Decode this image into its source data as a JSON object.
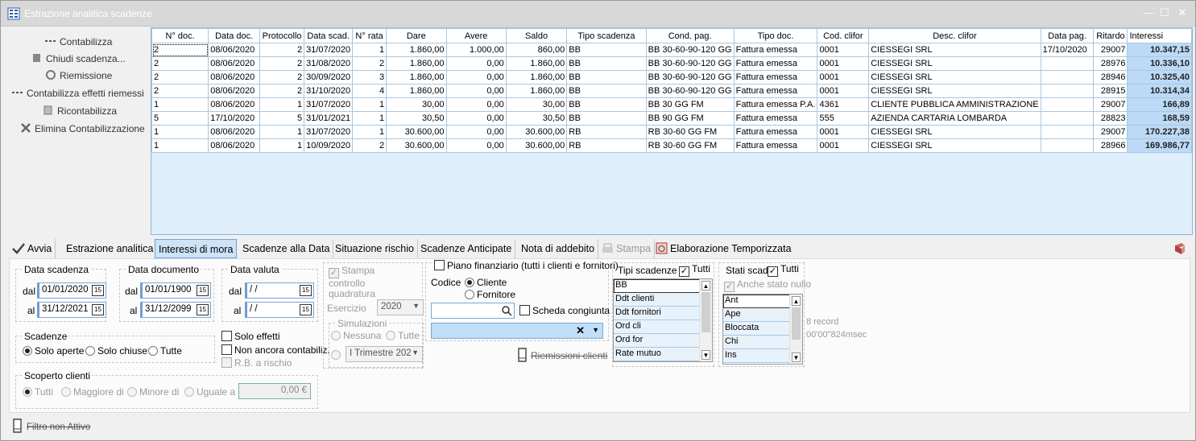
{
  "window": {
    "title": "Estrazione analitica scadenze",
    "min": "—",
    "max": "☐",
    "close": "✕"
  },
  "sidebar": {
    "items": [
      {
        "label": "Contabilizza",
        "icon": "dashes-icon"
      },
      {
        "label": "Chiudi scadenza...",
        "icon": "document-icon"
      },
      {
        "label": "Riemissione",
        "icon": "recycle-icon"
      },
      {
        "label": "Contabilizza effetti riemessi",
        "icon": "dashes-icon"
      },
      {
        "label": "Ricontabilizza",
        "icon": "document-icon"
      },
      {
        "label": "Elimina Contabilizzazione",
        "icon": "delete-icon"
      }
    ]
  },
  "grid": {
    "columns": [
      "N° doc.",
      "Data doc.",
      "Protocollo",
      "Data scad.",
      "N° rata",
      "Dare",
      "Avere",
      "Saldo",
      "Tipo scadenza",
      "Cond. pag.",
      "Tipo doc.",
      "Cod. clifor",
      "Desc. clifor",
      "Data pag.",
      "Ritardo",
      "Interessi"
    ],
    "rows": [
      [
        "2",
        "08/06/2020",
        "2",
        "31/07/2020",
        "1",
        "1.860,00",
        "1.000,00",
        "860,00",
        "BB",
        "BB 30-60-90-120 GG",
        "Fattura emessa",
        "0001",
        "CIESSEGI SRL",
        "17/10/2020",
        "29007",
        "10.347,15"
      ],
      [
        "2",
        "08/06/2020",
        "2",
        "31/08/2020",
        "2",
        "1.860,00",
        "0,00",
        "1.860,00",
        "BB",
        "BB 30-60-90-120 GG",
        "Fattura emessa",
        "0001",
        "CIESSEGI SRL",
        "",
        "28976",
        "10.336,10"
      ],
      [
        "2",
        "08/06/2020",
        "2",
        "30/09/2020",
        "3",
        "1.860,00",
        "0,00",
        "1.860,00",
        "BB",
        "BB 30-60-90-120 GG",
        "Fattura emessa",
        "0001",
        "CIESSEGI SRL",
        "",
        "28946",
        "10.325,40"
      ],
      [
        "2",
        "08/06/2020",
        "2",
        "31/10/2020",
        "4",
        "1.860,00",
        "0,00",
        "1.860,00",
        "BB",
        "BB 30-60-90-120 GG",
        "Fattura emessa",
        "0001",
        "CIESSEGI SRL",
        "",
        "28915",
        "10.314,34"
      ],
      [
        "1",
        "08/06/2020",
        "1",
        "31/07/2020",
        "1",
        "30,00",
        "0,00",
        "30,00",
        "BB",
        "BB 30 GG FM",
        "Fattura emessa P.A.",
        "4361",
        "CLIENTE PUBBLICA AMMINISTRAZIONE",
        "",
        "29007",
        "166,89"
      ],
      [
        "5",
        "17/10/2020",
        "5",
        "31/01/2021",
        "1",
        "30,50",
        "0,00",
        "30,50",
        "BB",
        "BB 90 GG FM",
        "Fattura emessa",
        "555",
        "AZIENDA CARTARIA LOMBARDA",
        "",
        "28823",
        "168,59"
      ],
      [
        "1",
        "08/06/2020",
        "1",
        "31/07/2020",
        "1",
        "30.600,00",
        "0,00",
        "30.600,00",
        "RB",
        "RB 30-60 GG FM",
        "Fattura emessa",
        "0001",
        "CIESSEGI SRL",
        "",
        "29007",
        "170.227,38"
      ],
      [
        "1",
        "08/06/2020",
        "1",
        "10/09/2020",
        "2",
        "30.600,00",
        "0,00",
        "30.600,00",
        "RB",
        "RB 30-60 GG FM",
        "Fattura emessa",
        "0001",
        "CIESSEGI SRL",
        "",
        "28966",
        "169.986,77"
      ]
    ]
  },
  "tabs": {
    "avvia": "Avvia",
    "estrazione": "Estrazione analitica",
    "interessi": "Interessi di mora",
    "scadenze_data": "Scadenze alla Data",
    "rischio": "Situazione rischio",
    "anticipate": "Scadenze Anticipate",
    "nota": "Nota di addebito",
    "stampa": "Stampa",
    "elaborazione": "Elaborazione Temporizzata"
  },
  "filters": {
    "data_scadenza": {
      "title": "Data scadenza",
      "dal_label": "dal",
      "al_label": "al",
      "dal": "01/01/2020",
      "al": "31/12/2021"
    },
    "data_documento": {
      "title": "Data documento",
      "dal_label": "dal",
      "al_label": "al",
      "dal": "01/01/1900",
      "al": "31/12/2099"
    },
    "data_valuta": {
      "title": "Data valuta",
      "dal_label": "dal",
      "al_label": "al",
      "dal": " / /",
      "al": " / /"
    },
    "cal_glyph": "15",
    "scadenze": {
      "title": "Scadenze",
      "aperte": "Solo aperte",
      "chiuse": "Solo chiuse",
      "tutte": "Tutte"
    },
    "solo_effetti": "Solo effetti",
    "non_contab": "Non ancora contabiliz.",
    "rb_rischio": "R.B. a rischio",
    "scoperto": {
      "title": "Scoperto clienti",
      "tutti": "Tutti",
      "maggiore": "Maggiore di",
      "minore": "Minore di",
      "uguale": "Uguale a",
      "value": "0,00 €"
    },
    "stampa_controllo": "Stampa controllo quadratura",
    "esercizio_label": "Esercizio",
    "esercizio": "2020",
    "simulazioni": {
      "title": "Simulazioni",
      "nessuna": "Nessuna",
      "tutte": "Tutte",
      "trimestre": "I Trimestre 202"
    },
    "piano": "Piano finanziario (tutti i clienti e fornitori)",
    "codice_label": "Codice",
    "cliente": "Cliente",
    "fornitore": "Fornitore",
    "scheda": "Scheda congiunta",
    "riemissioni": "Riemissioni clienti",
    "tipi_scadenze": {
      "title": "Tipi scadenze",
      "tutti": "Tutti",
      "items": [
        "BB",
        "Ddt clienti",
        "Ddt fornitori",
        "Ord cli",
        "Ord for",
        "Rate mutuo"
      ]
    },
    "stati_scad": {
      "title": "Stati scad.",
      "tutti": "Tutti",
      "anche_nullo": "Anche stato nullo",
      "items": [
        "Ant",
        "Ape",
        "Bloccata",
        "Chi",
        "Ins"
      ]
    },
    "record_count": "8 record",
    "timing": "00'00\"824msec"
  },
  "status": {
    "filtro": "Filtro non Attivo"
  }
}
